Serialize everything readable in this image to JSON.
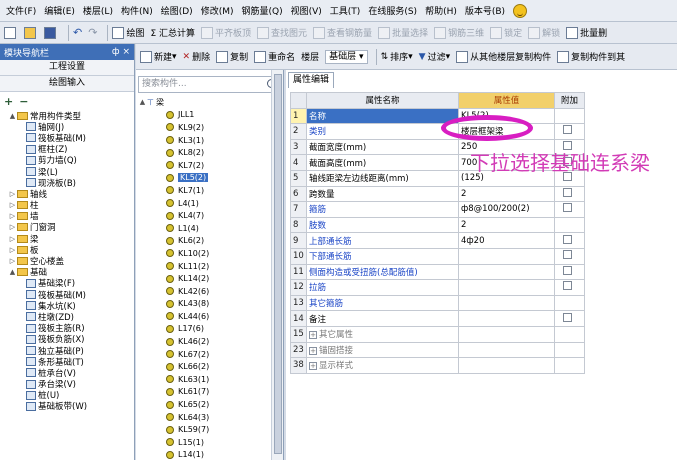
{
  "menu": [
    "文件(F)",
    "编辑(E)",
    "楼层(L)",
    "构件(N)",
    "绘图(D)",
    "修改(M)",
    "钢筋量(Q)",
    "视图(V)",
    "工具(T)",
    "在线服务(S)",
    "帮助(H)",
    "版本号(B)"
  ],
  "toolbar1": {
    "draw": "绘图",
    "sum": "Σ 汇总计算",
    "items_disabled": [
      "平齐板顶",
      "查找图元",
      "查看钢筋量",
      "批量选择",
      "钢筋三维",
      "锁定",
      "解锁"
    ],
    "batch_delete": "批量删"
  },
  "left": {
    "title": "模块导航栏",
    "pin": "ф ×",
    "btn_settings": "工程设置",
    "btn_draw_input": "绘图输入",
    "tree": [
      {
        "label": "常用构件类型",
        "level": 0,
        "type": "folder",
        "exp": "▲"
      },
      {
        "label": "轴网(J)",
        "level": 1,
        "type": "item"
      },
      {
        "label": "筏板基础(M)",
        "level": 1,
        "type": "item"
      },
      {
        "label": "框柱(Z)",
        "level": 1,
        "type": "item"
      },
      {
        "label": "剪力墙(Q)",
        "level": 1,
        "type": "item"
      },
      {
        "label": "梁(L)",
        "level": 1,
        "type": "item"
      },
      {
        "label": "现浇板(B)",
        "level": 1,
        "type": "item"
      },
      {
        "label": "轴线",
        "level": 0,
        "type": "folder",
        "exp": "▷"
      },
      {
        "label": "柱",
        "level": 0,
        "type": "folder",
        "exp": "▷"
      },
      {
        "label": "墙",
        "level": 0,
        "type": "folder",
        "exp": "▷"
      },
      {
        "label": "门窗洞",
        "level": 0,
        "type": "folder",
        "exp": "▷"
      },
      {
        "label": "梁",
        "level": 0,
        "type": "folder",
        "exp": "▷"
      },
      {
        "label": "板",
        "level": 0,
        "type": "folder",
        "exp": "▷"
      },
      {
        "label": "空心楼盖",
        "level": 0,
        "type": "folder",
        "exp": "▷"
      },
      {
        "label": "基础",
        "level": 0,
        "type": "folder",
        "exp": "▲"
      },
      {
        "label": "基础梁(F)",
        "level": 1,
        "type": "item"
      },
      {
        "label": "筏板基础(M)",
        "level": 1,
        "type": "item"
      },
      {
        "label": "集水坑(K)",
        "level": 1,
        "type": "item"
      },
      {
        "label": "柱墩(ZD)",
        "level": 1,
        "type": "item"
      },
      {
        "label": "筏板主筋(R)",
        "level": 1,
        "type": "item"
      },
      {
        "label": "筏板负筋(X)",
        "level": 1,
        "type": "item"
      },
      {
        "label": "独立基础(P)",
        "level": 1,
        "type": "item"
      },
      {
        "label": "条形基础(T)",
        "level": 1,
        "type": "item"
      },
      {
        "label": "桩承台(V)",
        "level": 1,
        "type": "item"
      },
      {
        "label": "承台梁(V)",
        "level": 1,
        "type": "item"
      },
      {
        "label": "桩(U)",
        "level": 1,
        "type": "item"
      },
      {
        "label": "基础板带(W)",
        "level": 1,
        "type": "item"
      }
    ]
  },
  "toolbar2": {
    "new": "新建",
    "delete": "删除",
    "copy": "复制",
    "rename": "重命名",
    "floor_label": "楼层",
    "floor_value": "基础层",
    "sort": "排序",
    "filter": "过滤",
    "copy_from": "从其他楼层复制构件",
    "copy_to": "复制构件到其"
  },
  "mid": {
    "search_placeholder": "搜索构件...",
    "root": "梁",
    "items": [
      "JLL1",
      "KL9(2)",
      "KL3(1)",
      "KL8(2)",
      "KL7(2)",
      "KL5(2)",
      "KL7(1)",
      "L4(1)",
      "KL4(7)",
      "L1(4)",
      "KL6(2)",
      "KL10(2)",
      "KL11(2)",
      "KL14(2)",
      "KL42(6)",
      "KL43(8)",
      "KL44(6)",
      "L17(6)",
      "KL46(2)",
      "KL67(2)",
      "KL66(2)",
      "KL63(1)",
      "KL61(7)",
      "KL65(2)",
      "KL64(3)",
      "KL59(7)",
      "L15(1)",
      "L14(1)"
    ],
    "selected_index": 5
  },
  "props": {
    "tab": "属性编辑",
    "headers": {
      "name": "属性名称",
      "value": "属性值",
      "extra": "附加"
    },
    "rows": [
      {
        "num": "1",
        "name": "名称",
        "value": "KL5(2)",
        "style": "sel",
        "chk": false
      },
      {
        "num": "2",
        "name": "类别",
        "value": "楼层框架梁",
        "style": "blue",
        "chk": true
      },
      {
        "num": "3",
        "name": "截面宽度(mm)",
        "value": "250",
        "style": "normal",
        "chk": true
      },
      {
        "num": "4",
        "name": "截面高度(mm)",
        "value": "700",
        "style": "normal",
        "chk": true
      },
      {
        "num": "5",
        "name": "轴线距梁左边线距离(mm)",
        "value": "(125)",
        "style": "normal",
        "chk": true
      },
      {
        "num": "6",
        "name": "跨数量",
        "value": "2",
        "style": "normal",
        "chk": true
      },
      {
        "num": "7",
        "name": "箍筋",
        "value": "ф8@100/200(2)",
        "style": "blue",
        "chk": true
      },
      {
        "num": "8",
        "name": "肢数",
        "value": "2",
        "style": "blue",
        "chk": false
      },
      {
        "num": "9",
        "name": "上部通长筋",
        "value": "4ф20",
        "style": "blue",
        "chk": true
      },
      {
        "num": "10",
        "name": "下部通长筋",
        "value": "",
        "style": "blue",
        "chk": true
      },
      {
        "num": "11",
        "name": "侧面构造或受扭筋(总配筋值)",
        "value": "",
        "style": "blue",
        "chk": true
      },
      {
        "num": "12",
        "name": "拉筋",
        "value": "",
        "style": "blue",
        "chk": true
      },
      {
        "num": "13",
        "name": "其它箍筋",
        "value": "",
        "style": "blue",
        "chk": false
      },
      {
        "num": "14",
        "name": "备注",
        "value": "",
        "style": "normal",
        "chk": true
      },
      {
        "num": "15",
        "name": "其它属性",
        "value": "",
        "style": "group",
        "chk": false
      },
      {
        "num": "23",
        "name": "锚固搭接",
        "value": "",
        "style": "group",
        "chk": false
      },
      {
        "num": "38",
        "name": "显示样式",
        "value": "",
        "style": "group",
        "chk": false
      }
    ]
  },
  "annotation": "下拉选择基础连系梁",
  "colors": {
    "accent": "#3a70c4",
    "annotation": "#d23bb6",
    "ellipse": "#d81ec2"
  }
}
